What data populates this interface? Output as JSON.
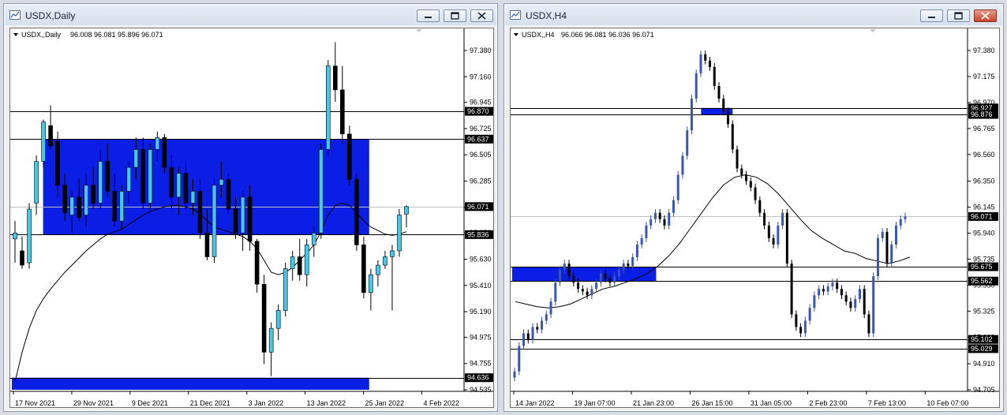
{
  "windows": [
    {
      "title": "USDX,Daily",
      "info_symbol": "USDX,,Daily",
      "info_ohlc": "96.008 96.081 95.896 96.071",
      "price_labels": [
        "97.380",
        "97.160",
        "96.945",
        "96.725",
        "96.505",
        "96.285",
        "96.065",
        "95.850",
        "95.630",
        "95.410",
        "95.190",
        "94.975",
        "94.755",
        "94.535"
      ],
      "time_labels": [
        "17 Nov 2021",
        "29 Nov 2021",
        "9 Dec 2021",
        "21 Dec 2021",
        "3 Jan 2022",
        "13 Jan 2022",
        "25 Jan 2022",
        "4 Feb 2022"
      ],
      "level_tags": [
        {
          "label": "96.870",
          "value": 96.87
        },
        {
          "label": "96.637",
          "value": 96.637
        },
        {
          "label": "96.071",
          "value": 96.071
        },
        {
          "label": "95.836",
          "value": 95.836
        },
        {
          "label": "94.636",
          "value": 94.636
        }
      ],
      "colors": {
        "bull": "#44c8ec",
        "bear": "#000000",
        "zone": "#0a1ee6",
        "tag": "#000000"
      }
    },
    {
      "title": "USDX,H4",
      "info_symbol": "USDX,,H4",
      "info_ohlc": "96.066 96.081 96.036 96.071",
      "price_labels": [
        "97.380",
        "97.175",
        "96.970",
        "96.765",
        "96.560",
        "96.350",
        "96.145",
        "95.940",
        "95.735",
        "95.530",
        "95.325",
        "95.120",
        "94.910",
        "94.705"
      ],
      "time_labels": [
        "14 Jan 2022",
        "19 Jan 07:00",
        "21 Jan 23:00",
        "26 Jan 15:00",
        "31 Jan 05:00",
        "2 Feb 23:00",
        "7 Feb 13:00",
        "10 Feb 07:00"
      ],
      "level_tags": [
        {
          "label": "96.927",
          "value": 96.927
        },
        {
          "label": "96.876",
          "value": 96.876
        },
        {
          "label": "96.071",
          "value": 96.071
        },
        {
          "label": "95.675",
          "value": 95.675
        },
        {
          "label": "95.562",
          "value": 95.562
        },
        {
          "label": "95.102",
          "value": 95.102
        },
        {
          "label": "95.029",
          "value": 95.029
        }
      ],
      "colors": {
        "bull": "#3a56b4",
        "bear": "#000000",
        "zone": "#0a1ee6",
        "tag": "#000000"
      }
    }
  ],
  "icons": {
    "chart_window": "chart-window-icon",
    "minimize": "minimize-icon",
    "maximize": "maximize-icon",
    "close": "close-icon",
    "dropdown": "triangle-down-icon"
  },
  "chart_data": [
    {
      "type": "candlestick",
      "title": "USDX,Daily",
      "ylim": [
        94.535,
        97.38
      ],
      "x": [
        "17 Nov 2021",
        "29 Nov 2021",
        "9 Dec 2021",
        "21 Dec 2021",
        "3 Jan 2022",
        "13 Jan 2022",
        "25 Jan 2022",
        "4 Feb 2022"
      ],
      "last_ohlc": {
        "open": 96.008,
        "high": 96.081,
        "low": 95.896,
        "close": 96.071
      },
      "candles_ohlc": [
        [
          95.8,
          95.95,
          95.6,
          95.85
        ],
        [
          95.7,
          95.82,
          95.55,
          95.58
        ],
        [
          95.6,
          96.1,
          95.55,
          96.05
        ],
        [
          96.1,
          96.5,
          96.0,
          96.45
        ],
        [
          96.45,
          96.8,
          96.4,
          96.78
        ],
        [
          96.75,
          96.92,
          96.55,
          96.58
        ],
        [
          96.62,
          96.7,
          96.15,
          96.25
        ],
        [
          96.25,
          96.35,
          95.95,
          96.02
        ],
        [
          96.0,
          96.2,
          95.85,
          96.15
        ],
        [
          96.15,
          96.3,
          95.95,
          95.98
        ],
        [
          96.0,
          96.35,
          95.9,
          96.25
        ],
        [
          96.25,
          96.4,
          96.05,
          96.1
        ],
        [
          96.1,
          96.55,
          96.05,
          96.45
        ],
        [
          96.45,
          96.6,
          96.15,
          96.2
        ],
        [
          96.2,
          96.35,
          95.9,
          95.95
        ],
        [
          95.95,
          96.25,
          95.88,
          96.2
        ],
        [
          96.2,
          96.45,
          96.1,
          96.4
        ],
        [
          96.4,
          96.65,
          96.3,
          96.55
        ],
        [
          96.55,
          96.65,
          96.05,
          96.1
        ],
        [
          96.1,
          96.6,
          96.05,
          96.55
        ],
        [
          96.55,
          96.7,
          96.45,
          96.65
        ],
        [
          96.65,
          96.68,
          96.35,
          96.4
        ],
        [
          96.4,
          96.5,
          96.05,
          96.15
        ],
        [
          96.15,
          96.4,
          96.0,
          96.35
        ],
        [
          96.35,
          96.42,
          96.05,
          96.1
        ],
        [
          96.1,
          96.3,
          96.0,
          96.2
        ],
        [
          96.2,
          96.3,
          95.8,
          95.85
        ],
        [
          95.85,
          96.05,
          95.62,
          95.65
        ],
        [
          95.65,
          96.3,
          95.6,
          96.25
        ],
        [
          96.25,
          96.45,
          96.15,
          96.3
        ],
        [
          96.3,
          96.35,
          96.02,
          96.05
        ],
        [
          96.05,
          96.15,
          95.8,
          95.85
        ],
        [
          95.85,
          96.2,
          95.7,
          96.15
        ],
        [
          96.15,
          96.25,
          95.7,
          95.78
        ],
        [
          95.78,
          95.8,
          95.35,
          95.42
        ],
        [
          95.42,
          95.5,
          94.75,
          94.85
        ],
        [
          94.85,
          95.1,
          94.65,
          95.05
        ],
        [
          95.05,
          95.25,
          94.95,
          95.2
        ],
        [
          95.2,
          95.6,
          95.15,
          95.55
        ],
        [
          95.55,
          95.7,
          95.45,
          95.65
        ],
        [
          95.65,
          95.8,
          95.45,
          95.5
        ],
        [
          95.5,
          95.8,
          95.4,
          95.75
        ],
        [
          95.75,
          95.9,
          95.65,
          95.85
        ],
        [
          95.85,
          96.6,
          95.8,
          96.55
        ],
        [
          96.55,
          97.3,
          96.5,
          97.25
        ],
        [
          97.25,
          97.45,
          96.95,
          97.05
        ],
        [
          97.05,
          97.25,
          96.6,
          96.68
        ],
        [
          96.68,
          96.75,
          96.25,
          96.3
        ],
        [
          96.3,
          96.35,
          95.7,
          95.75
        ],
        [
          95.75,
          95.82,
          95.3,
          95.35
        ],
        [
          95.35,
          95.55,
          95.2,
          95.5
        ],
        [
          95.5,
          95.62,
          95.4,
          95.58
        ],
        [
          95.58,
          95.7,
          95.55,
          95.65
        ],
        [
          95.65,
          95.75,
          95.2,
          95.7
        ],
        [
          95.7,
          96.05,
          95.65,
          96.0
        ],
        [
          96.008,
          96.081,
          95.896,
          96.071
        ]
      ],
      "moving_average": [
        94.6,
        94.85,
        95.05,
        95.2,
        95.3,
        95.38,
        95.45,
        95.52,
        95.58,
        95.64,
        95.7,
        95.75,
        95.8,
        95.84,
        95.86,
        95.88,
        95.92,
        95.96,
        96.0,
        96.03,
        96.05,
        96.07,
        96.08,
        96.08,
        96.07,
        96.05,
        96.01,
        95.95,
        95.9,
        95.88,
        95.86,
        95.84,
        95.82,
        95.78,
        95.72,
        95.62,
        95.52,
        95.5,
        95.52,
        95.56,
        95.62,
        95.68,
        95.75,
        95.86,
        96.0,
        96.08,
        96.1,
        96.08,
        96.02,
        95.95,
        95.9,
        95.87,
        95.84,
        95.83,
        95.84,
        95.86
      ],
      "zones": [
        {
          "from": 96.637,
          "to": 95.836,
          "start": 0.07,
          "end": 0.8
        },
        {
          "from": 94.636,
          "to": 94.535,
          "start": 0.0,
          "end": 0.8
        }
      ],
      "hlines": [
        96.87,
        96.637,
        95.836,
        94.636
      ],
      "current_price": 96.071
    },
    {
      "type": "candlestick",
      "title": "USDX,H4",
      "ylim": [
        94.705,
        97.38
      ],
      "x": [
        "14 Jan 2022",
        "19 Jan 07:00",
        "21 Jan 23:00",
        "26 Jan 15:00",
        "31 Jan 05:00",
        "2 Feb 23:00",
        "7 Feb 13:00",
        "10 Feb 07:00"
      ],
      "last_ohlc": {
        "open": 96.066,
        "high": 96.081,
        "low": 96.036,
        "close": 96.071
      },
      "candles_close": [
        94.85,
        95.05,
        95.15,
        95.1,
        95.2,
        95.18,
        95.25,
        95.3,
        95.4,
        95.55,
        95.65,
        95.7,
        95.6,
        95.55,
        95.5,
        95.48,
        95.45,
        95.5,
        95.55,
        95.62,
        95.58,
        95.55,
        95.6,
        95.65,
        95.7,
        95.68,
        95.75,
        95.85,
        95.9,
        96.0,
        96.05,
        96.1,
        96.05,
        96.0,
        96.1,
        96.2,
        96.4,
        96.55,
        96.75,
        97.0,
        97.2,
        97.35,
        97.3,
        97.25,
        97.1,
        97.0,
        96.9,
        96.8,
        96.6,
        96.45,
        96.4,
        96.35,
        96.3,
        96.2,
        96.1,
        96.0,
        95.9,
        95.85,
        96.0,
        96.1,
        95.7,
        95.3,
        95.2,
        95.15,
        95.25,
        95.35,
        95.45,
        95.5,
        95.48,
        95.52,
        95.55,
        95.5,
        95.45,
        95.4,
        95.35,
        95.42,
        95.5,
        95.3,
        95.15,
        95.6,
        95.9,
        95.95,
        95.7,
        95.85,
        96.0,
        96.05,
        96.071
      ],
      "moving_average": [
        95.4,
        95.38,
        95.36,
        95.35,
        95.36,
        95.38,
        95.42,
        95.46,
        95.5,
        95.52,
        95.55,
        95.58,
        95.62,
        95.68,
        95.76,
        95.86,
        95.98,
        96.1,
        96.22,
        96.32,
        96.38,
        96.4,
        96.38,
        96.33,
        96.25,
        96.15,
        96.05,
        95.96,
        95.9,
        95.85,
        95.8,
        95.78,
        95.74,
        95.72,
        95.7,
        95.72,
        95.75
      ],
      "zones": [
        {
          "from": 95.675,
          "to": 95.562,
          "start": 0.0,
          "end": 0.32
        },
        {
          "from": 96.927,
          "to": 96.876,
          "start": 0.42,
          "end": 0.49
        }
      ],
      "hlines": [
        96.927,
        96.876,
        95.675,
        95.562,
        95.102,
        95.029
      ],
      "current_price": 96.071
    }
  ]
}
